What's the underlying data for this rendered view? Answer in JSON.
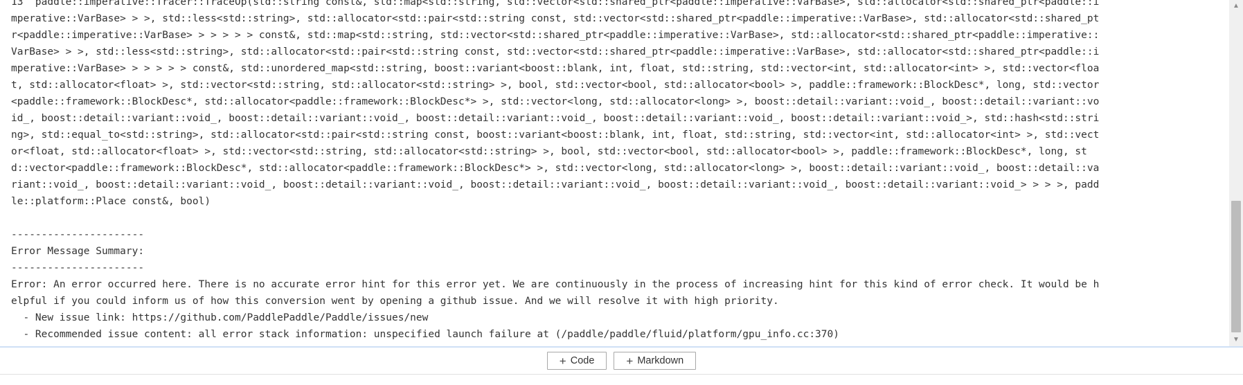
{
  "output": {
    "lines": [
      "13  paddle::imperative::Tracer::TraceOp(std::string const&, std::map<std::string, std::vector<std::shared_ptr<paddle::imperative::VarBase>, std::allocator<std::shared_ptr<paddle::i",
      "mperative::VarBase> > >, std::less<std::string>, std::allocator<std::pair<std::string const, std::vector<std::shared_ptr<paddle::imperative::VarBase>, std::allocator<std::shared_pt",
      "r<paddle::imperative::VarBase> > > > > > const&, std::map<std::string, std::vector<std::shared_ptr<paddle::imperative::VarBase>, std::allocator<std::shared_ptr<paddle::imperative::",
      "VarBase> > >, std::less<std::string>, std::allocator<std::pair<std::string const, std::vector<std::shared_ptr<paddle::imperative::VarBase>, std::allocator<std::shared_ptr<paddle::i",
      "mperative::VarBase> > > > > > const&, std::unordered_map<std::string, boost::variant<boost::blank, int, float, std::string, std::vector<int, std::allocator<int> >, std::vector<floa",
      "t, std::allocator<float> >, std::vector<std::string, std::allocator<std::string> >, bool, std::vector<bool, std::allocator<bool> >, paddle::framework::BlockDesc*, long, std::vector",
      "<paddle::framework::BlockDesc*, std::allocator<paddle::framework::BlockDesc*> >, std::vector<long, std::allocator<long> >, boost::detail::variant::void_, boost::detail::variant::vo",
      "id_, boost::detail::variant::void_, boost::detail::variant::void_, boost::detail::variant::void_, boost::detail::variant::void_, boost::detail::variant::void_>, std::hash<std::stri",
      "ng>, std::equal_to<std::string>, std::allocator<std::pair<std::string const, boost::variant<boost::blank, int, float, std::string, std::vector<int, std::allocator<int> >, std::vect",
      "or<float, std::allocator<float> >, std::vector<std::string, std::allocator<std::string> >, bool, std::vector<bool, std::allocator<bool> >, paddle::framework::BlockDesc*, long, st",
      "d::vector<paddle::framework::BlockDesc*, std::allocator<paddle::framework::BlockDesc*> >, std::vector<long, std::allocator<long> >, boost::detail::variant::void_, boost::detail::va",
      "riant::void_, boost::detail::variant::void_, boost::detail::variant::void_, boost::detail::variant::void_, boost::detail::variant::void_, boost::detail::variant::void_> > > >, padd",
      "le::platform::Place const&, bool)",
      "",
      "----------------------",
      "Error Message Summary:",
      "----------------------",
      "Error: An error occurred here. There is no accurate error hint for this error yet. We are continuously in the process of increasing hint for this kind of error check. It would be h",
      "elpful if you could inform us of how this conversion went by opening a github issue. And we will resolve it with high priority.",
      "  - New issue link: https://github.com/PaddlePaddle/Paddle/issues/new",
      "  - Recommended issue content: all error stack information: unspecified launch failure at (/paddle/paddle/fluid/platform/gpu_info.cc:370)"
    ]
  },
  "scrollbar": {
    "up_icon": "triangle-up-icon",
    "down_icon": "triangle-down-icon"
  },
  "toolbar": {
    "add_code_label": "Code",
    "add_markdown_label": "Markdown",
    "plus_icon": "plus-icon",
    "plus_glyph": "+"
  },
  "colors": {
    "output_text": "#333333",
    "divider_accent": "#cfe0f5",
    "scrollbar_track": "#f0f0f0",
    "scrollbar_thumb": "#bcbcbc"
  }
}
